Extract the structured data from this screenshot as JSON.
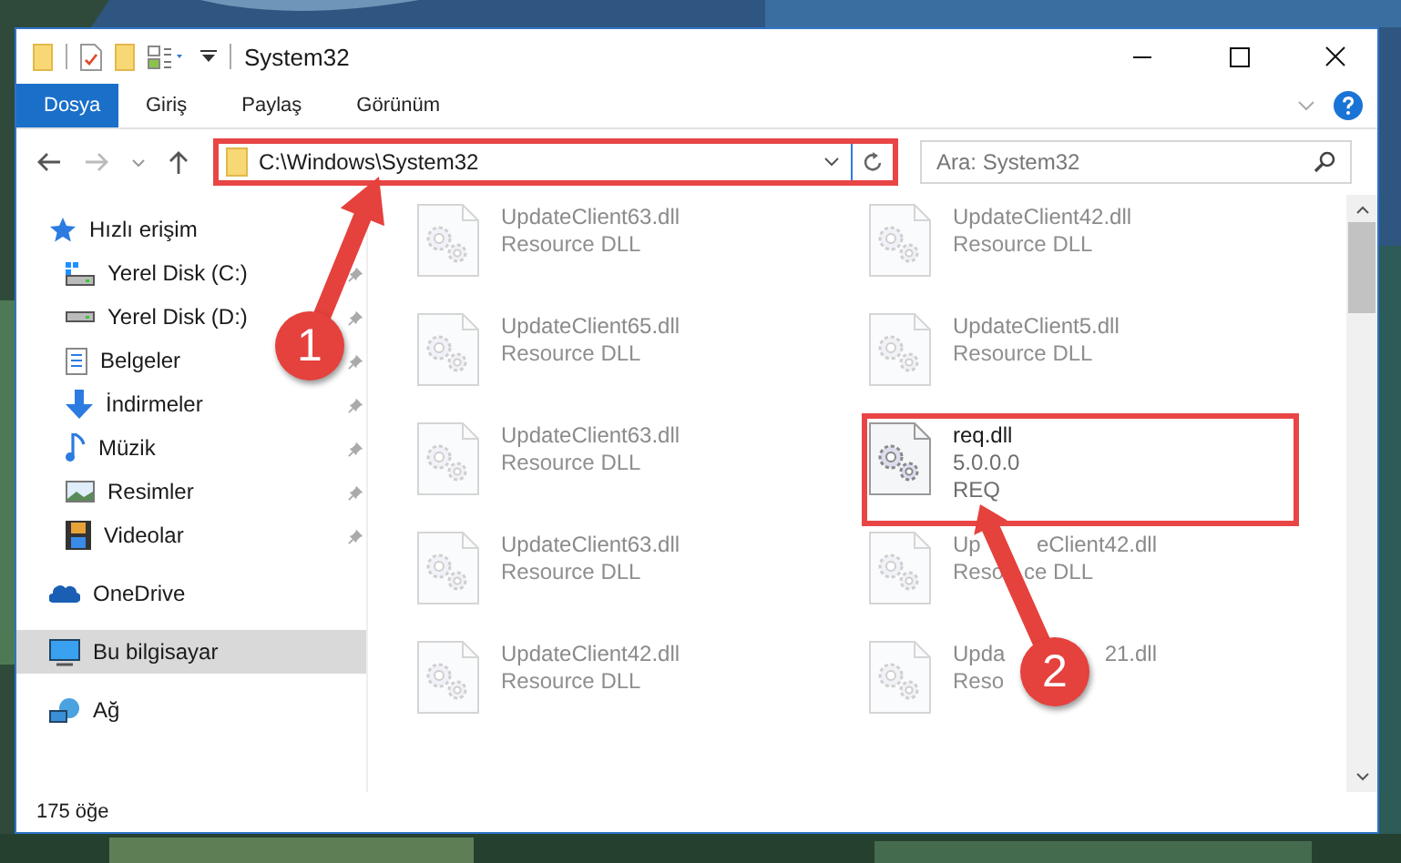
{
  "window": {
    "title": "System32"
  },
  "ribbon_tabs": [
    {
      "label": "Dosya",
      "selected": true
    },
    {
      "label": "Giriş",
      "selected": false
    },
    {
      "label": "Paylaş",
      "selected": false
    },
    {
      "label": "Görünüm",
      "selected": false
    }
  ],
  "address": {
    "value": "C:\\Windows\\System32",
    "marked": true
  },
  "search": {
    "placeholder": "Ara: System32"
  },
  "navigation": [
    {
      "label": "Hızlı erişim",
      "kind": "star",
      "selected": false,
      "children": [
        {
          "label": "Yerel Disk (C:)",
          "kind": "sysdrive",
          "pinned": true,
          "selected": false
        },
        {
          "label": "Yerel Disk (D:)",
          "kind": "drive",
          "pinned": true,
          "selected": false
        },
        {
          "label": "Belgeler",
          "kind": "document",
          "pinned": true,
          "selected": false
        },
        {
          "label": "İndirmeler",
          "kind": "download",
          "pinned": true,
          "selected": false
        },
        {
          "label": "Müzik",
          "kind": "music",
          "pinned": true,
          "selected": false
        },
        {
          "label": "Resimler",
          "kind": "pictures",
          "pinned": true,
          "selected": false
        },
        {
          "label": "Videolar",
          "kind": "videos",
          "pinned": true,
          "selected": false
        }
      ]
    },
    {
      "label": "OneDrive",
      "kind": "cloud",
      "selected": false
    },
    {
      "label": "Bu bilgisayar",
      "kind": "computer",
      "selected": true
    },
    {
      "label": "Ağ",
      "kind": "network",
      "selected": false
    }
  ],
  "files": [
    {
      "name": "UpdateClient63.dll",
      "lines": [
        "Resource DLL"
      ],
      "dimmed": true,
      "marked": false
    },
    {
      "name": "UpdateClient65.dll",
      "lines": [
        "Resource DLL"
      ],
      "dimmed": true,
      "marked": false
    },
    {
      "name": "UpdateClient63.dll",
      "lines": [
        "Resource DLL"
      ],
      "dimmed": true,
      "marked": false
    },
    {
      "name": "UpdateClient63.dll",
      "lines": [
        "Resource DLL"
      ],
      "dimmed": true,
      "marked": false
    },
    {
      "name": "UpdateClient42.dll",
      "lines": [
        "Resource DLL"
      ],
      "dimmed": true,
      "marked": false
    },
    {
      "name": "UpdateClient42.dll",
      "lines": [
        "Resource DLL"
      ],
      "dimmed": true,
      "marked": false
    },
    {
      "name": "UpdateClient5.dll",
      "lines": [
        "Resource DLL"
      ],
      "dimmed": true,
      "marked": false
    },
    {
      "name": "req.dll",
      "lines": [
        "5.0.0.0",
        "REQ"
      ],
      "dimmed": false,
      "marked": true
    },
    {
      "name": [
        "Up",
        "eClient42.dll"
      ],
      "lines": [
        [
          "Reso",
          "ce DLL"
        ]
      ],
      "dimmed": true,
      "marked": false
    },
    {
      "name": [
        "Upda",
        "21.dll"
      ],
      "lines": [
        [
          "Reso"
        ]
      ],
      "dimmed": true,
      "marked": false
    }
  ],
  "status_bar": {
    "count": "175 öğe"
  },
  "annotations": [
    {
      "label": "1"
    },
    {
      "label": "2"
    }
  ]
}
